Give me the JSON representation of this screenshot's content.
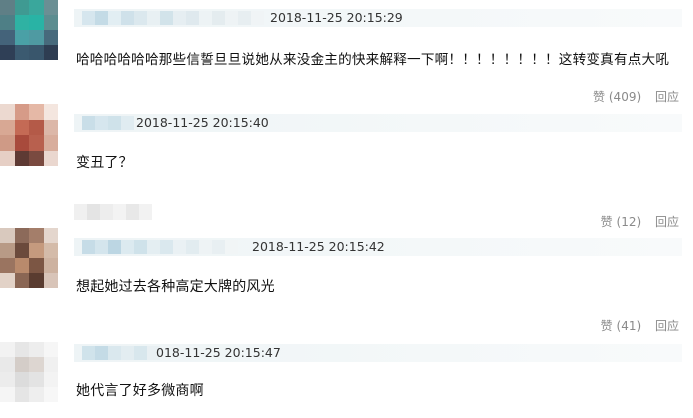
{
  "comments": [
    {
      "timestamp": "2018-11-25 20:15:29",
      "text": "哈哈哈哈哈哈那些信誓旦旦说她从来没金主的快来解释一下啊！！！！！！！！这转变真有点大吼",
      "like_label": "赞",
      "like_count": "(409)",
      "reply_label": "回应"
    },
    {
      "timestamp": "2018-11-25 20:15:40",
      "text": "变丑了？",
      "like_label": "赞",
      "like_count": "(12)",
      "reply_label": "回应"
    },
    {
      "timestamp": "2018-11-25 20:15:42",
      "text": "想起她过去各种高定大牌的风光",
      "like_label": "赞",
      "like_count": "(41)",
      "reply_label": "回应"
    },
    {
      "timestamp": "018-11-25 20:15:47",
      "text": "她代言了好多微商啊"
    }
  ],
  "colors": {
    "header_bar": "#eef4f6",
    "action_text": "#8a8a8a",
    "body_text": "#111111"
  }
}
